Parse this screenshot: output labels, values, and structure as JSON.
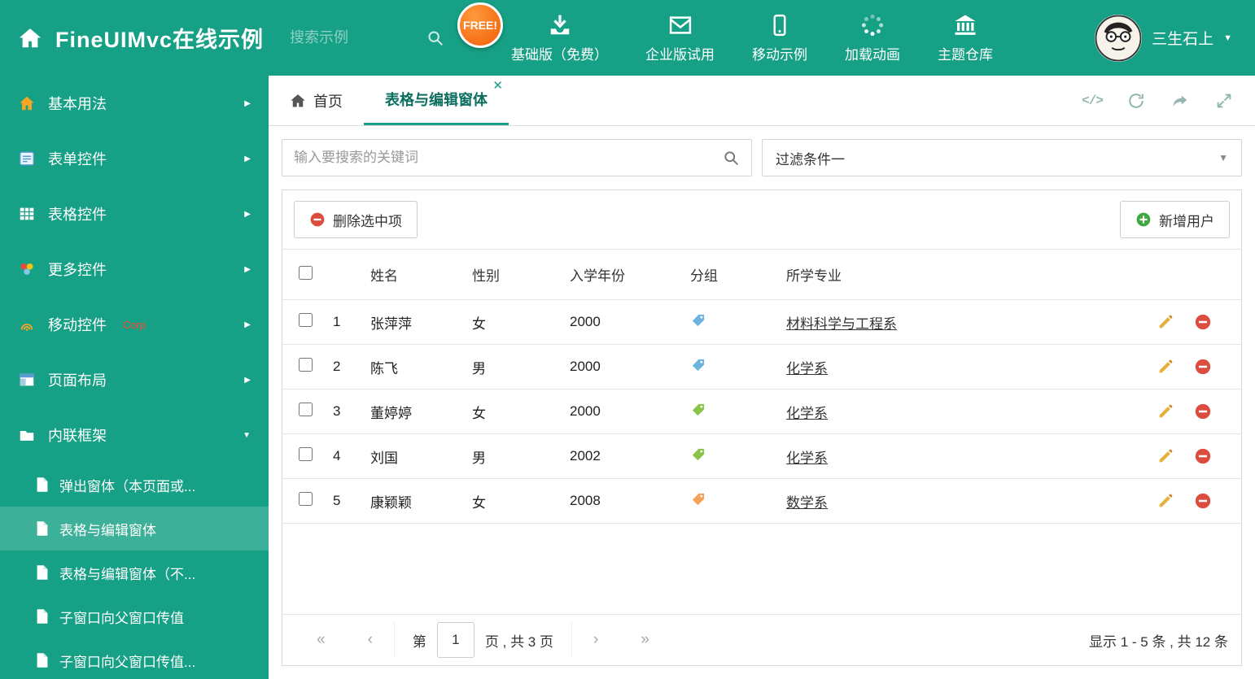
{
  "colors": {
    "theme": "#16a085",
    "badge_orange": "#f25c05",
    "delete_red": "#dc4c3f",
    "add_green": "#3ea73e",
    "pencil_yellow": "#e5b13c"
  },
  "header": {
    "title": "FineUIMvc在线示例",
    "search_placeholder": "搜索示例",
    "nav": [
      {
        "label": "基础版（免费）",
        "icon": "download-icon",
        "badge": "FREE!"
      },
      {
        "label": "企业版试用",
        "icon": "mail-icon"
      },
      {
        "label": "移动示例",
        "icon": "mobile-icon"
      },
      {
        "label": "加载动画",
        "icon": "spinner-icon"
      },
      {
        "label": "主题仓库",
        "icon": "bank-icon"
      }
    ],
    "user_name": "三生石上"
  },
  "sidebar": {
    "items": [
      {
        "label": "基本用法",
        "icon": "home-orange-icon",
        "state": "collapsed"
      },
      {
        "label": "表单控件",
        "icon": "form-icon",
        "state": "collapsed"
      },
      {
        "label": "表格控件",
        "icon": "grid-icon",
        "state": "collapsed"
      },
      {
        "label": "更多控件",
        "icon": "more-icon",
        "state": "collapsed"
      },
      {
        "label": "移动控件",
        "icon": "signal-icon",
        "tag": "Corp",
        "state": "collapsed"
      },
      {
        "label": "页面布局",
        "icon": "layout-icon",
        "state": "collapsed"
      },
      {
        "label": "内联框架",
        "icon": "frame-icon",
        "state": "expanded",
        "children": [
          {
            "label": "弹出窗体（本页面或..."
          },
          {
            "label": "表格与编辑窗体",
            "selected": true
          },
          {
            "label": "表格与编辑窗体（不..."
          },
          {
            "label": "子窗口向父窗口传值"
          },
          {
            "label": "子窗口向父窗口传值..."
          }
        ]
      }
    ]
  },
  "tabs": {
    "items": [
      {
        "label": "首页",
        "icon": "home-solid-icon",
        "active": false
      },
      {
        "label": "表格与编辑窗体",
        "active": true,
        "closable": true
      }
    ],
    "tools": [
      "code-icon",
      "refresh-icon",
      "share-icon",
      "expand-icon"
    ]
  },
  "filter": {
    "search_placeholder": "输入要搜索的关键词",
    "dropdown_value": "过滤条件一"
  },
  "toolbar": {
    "delete_label": "删除选中项",
    "add_label": "新增用户"
  },
  "table": {
    "headers": {
      "name": "姓名",
      "gender": "性别",
      "year": "入学年份",
      "group": "分组",
      "major": "所学专业"
    },
    "rows": [
      {
        "index": "1",
        "name": "张萍萍",
        "gender": "女",
        "year": "2000",
        "tag_color": "#6db3e0",
        "major": "材料科学与工程系"
      },
      {
        "index": "2",
        "name": "陈飞",
        "gender": "男",
        "year": "2000",
        "tag_color": "#6db3e0",
        "major": "化学系"
      },
      {
        "index": "3",
        "name": "董婷婷",
        "gender": "女",
        "year": "2000",
        "tag_color": "#8bc34a",
        "major": "化学系"
      },
      {
        "index": "4",
        "name": "刘国",
        "gender": "男",
        "year": "2002",
        "tag_color": "#8bc34a",
        "major": "化学系"
      },
      {
        "index": "5",
        "name": "康颖颖",
        "gender": "女",
        "year": "2008",
        "tag_color": "#f4a259",
        "major": "数学系"
      }
    ]
  },
  "pagination": {
    "prefix": "第",
    "page_value": "1",
    "suffix": "页 , 共 3 页",
    "summary": "显示 1 - 5 条 , 共 12 条"
  }
}
